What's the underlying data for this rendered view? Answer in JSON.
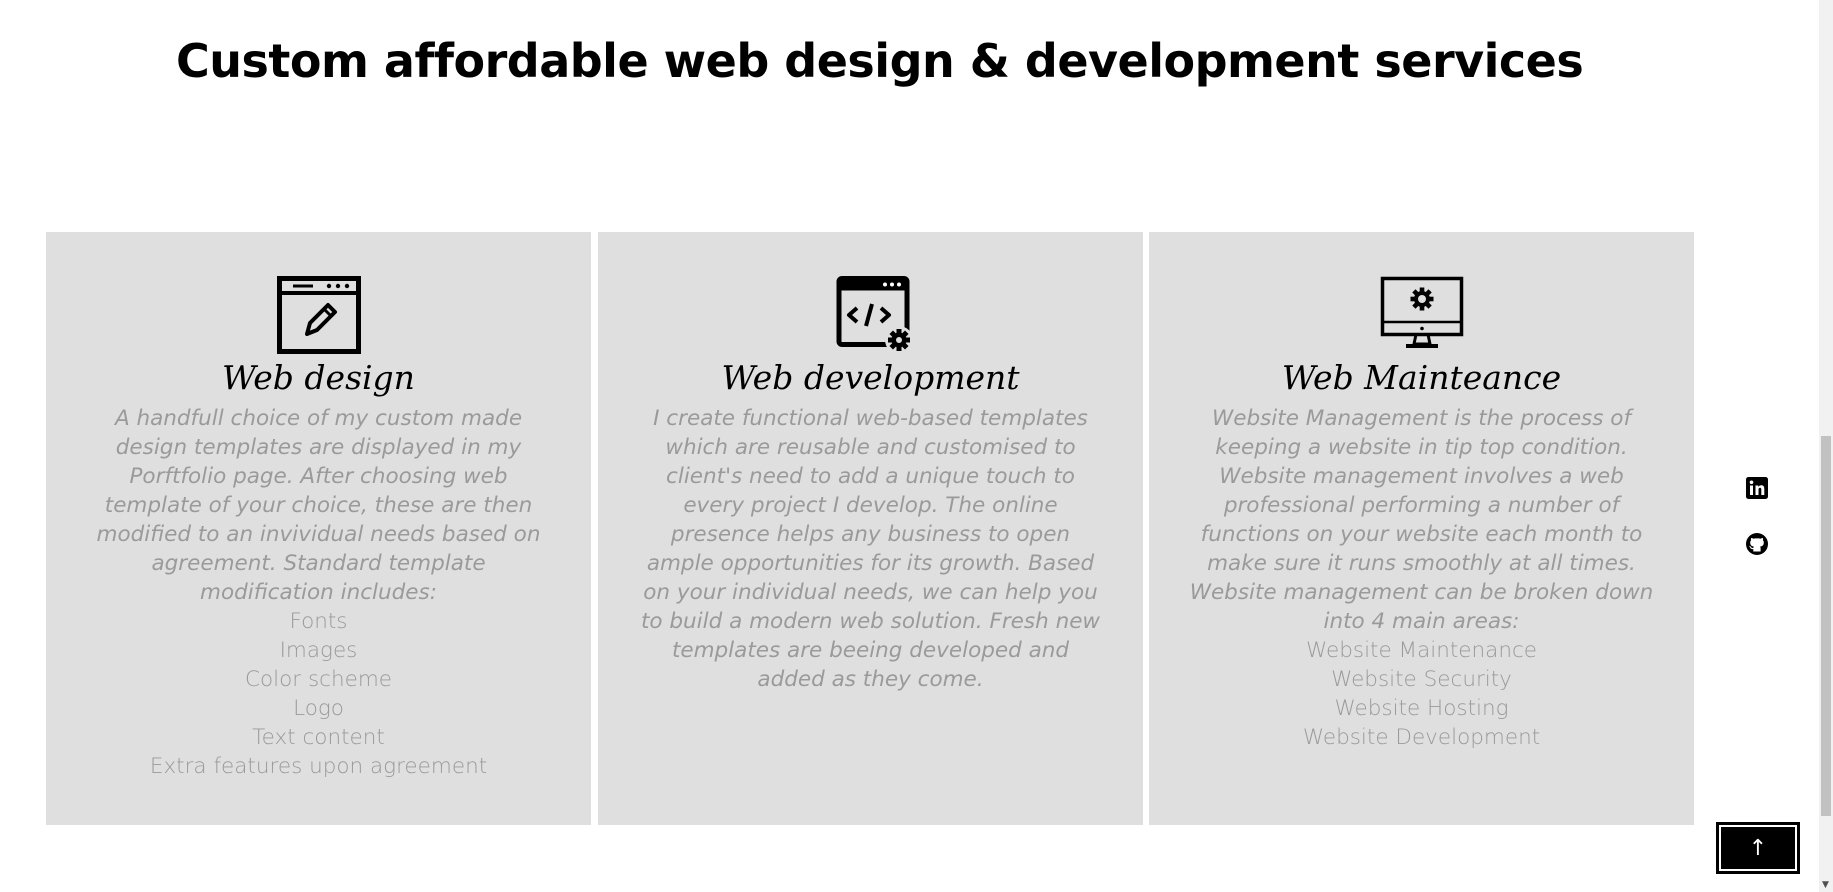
{
  "page": {
    "title": "Custom affordable web design & development services"
  },
  "services": [
    {
      "icon": "browser-edit-icon",
      "title": "Web design",
      "description": "A handfull choice of my custom made design templates are displayed in my Porftfolio page. After choosing web template of your choice, these are then modified to an invividual needs based on agreement. Standard template modification includes:",
      "items": [
        "Fonts",
        "Images",
        "Color scheme",
        "Logo",
        "Text content",
        "Extra features upon agreement"
      ]
    },
    {
      "icon": "browser-code-gear-icon",
      "title": "Web development",
      "description": "I create functional web-based templates which are reusable and customised to client's need to add a unique touch to every project I develop. The online presence helps any business to open ample opportunities for its growth. Based on your individual needs, we can help you to build a modern web solution. Fresh new templates are beeing developed and added as they come.",
      "items": []
    },
    {
      "icon": "monitor-gear-icon",
      "title": "Web Mainteance",
      "description": "Website Management is the process of keeping a website in tip top condition. Website management involves a web professional performing a number of functions on your website each month to make sure it runs smoothly at all times. Website management can be broken down into 4 main areas:",
      "items": [
        "Website Maintenance",
        "Website Security",
        "Website Hosting",
        "Website Development"
      ]
    }
  ],
  "social": [
    {
      "icon": "linkedin-icon"
    },
    {
      "icon": "github-icon"
    }
  ],
  "back_to_top": {
    "label": "↑"
  },
  "colors": {
    "card_background": "#dfdfdf",
    "body_text": "#9a9a9a",
    "heading": "#000000"
  }
}
